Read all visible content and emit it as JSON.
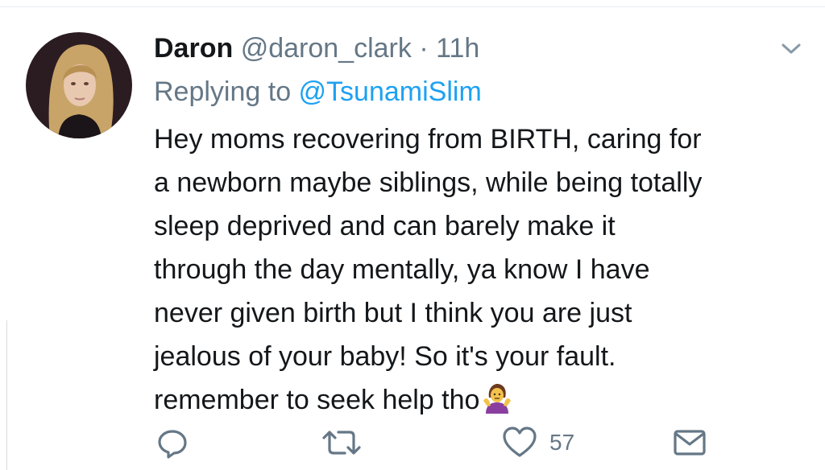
{
  "tweet": {
    "author_name": "Daron",
    "handle": "@daron_clark",
    "separator": "·",
    "time": "11h",
    "replying_prefix": "Replying to ",
    "replying_to": "@TsunamiSlim",
    "text_lines": [
      "Hey moms recovering from BIRTH, caring for",
      "a newborn maybe siblings, while being totally",
      "sleep deprived and can barely make it",
      "through the day mentally, ya know I have",
      "never given birth but I think you are just",
      "jealous of your baby! So it's your fault.",
      "remember to seek help tho"
    ],
    "trailing_emoji": "person-shrugging-emoji"
  },
  "actions": {
    "reply_icon": "reply-icon",
    "retweet_icon": "retweet-icon",
    "like_icon": "heart-icon",
    "like_count": "57",
    "dm_icon": "envelope-icon"
  },
  "colors": {
    "text": "#14171a",
    "secondary": "#657786",
    "link": "#1da1f2"
  }
}
